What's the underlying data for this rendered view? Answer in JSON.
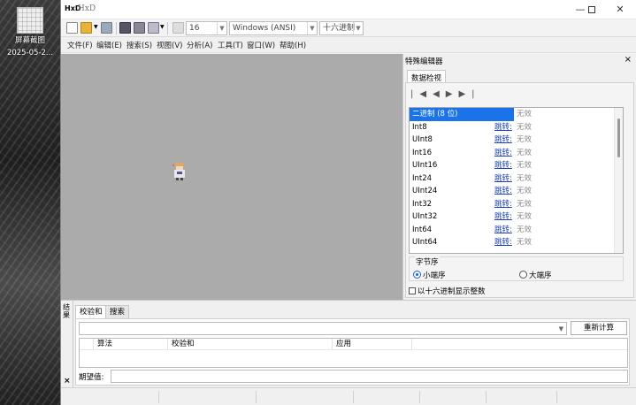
{
  "desktop": {
    "icon_label_line1": "屏幕截图",
    "icon_label_line2": "2025-05-2..."
  },
  "window": {
    "logo": "HxD",
    "title": "HxD",
    "minimize_icon": "minimize-icon",
    "maximize_icon": "maximize-icon",
    "close_icon": "close-icon"
  },
  "toolbar": {
    "bytes_per_row": "16",
    "charset": "Windows (ANSI)",
    "offset_base": "十六进制"
  },
  "menu": [
    "文件(F)",
    "编辑(E)",
    "搜索(S)",
    "视图(V)",
    "分析(A)",
    "工具(T)",
    "窗口(W)",
    "帮助(H)"
  ],
  "special_editor": {
    "title": "特殊编辑器",
    "close": "×",
    "tab": "数据检视",
    "rows": [
      {
        "name": "二进制 (8 位)",
        "jump": "",
        "value": "无效"
      },
      {
        "name": "Int8",
        "jump": "跳转:",
        "value": "无效"
      },
      {
        "name": "UInt8",
        "jump": "跳转:",
        "value": "无效"
      },
      {
        "name": "Int16",
        "jump": "跳转:",
        "value": "无效"
      },
      {
        "name": "UInt16",
        "jump": "跳转:",
        "value": "无效"
      },
      {
        "name": "Int24",
        "jump": "跳转:",
        "value": "无效"
      },
      {
        "name": "UInt24",
        "jump": "跳转:",
        "value": "无效"
      },
      {
        "name": "Int32",
        "jump": "跳转:",
        "value": "无效"
      },
      {
        "name": "UInt32",
        "jump": "跳转:",
        "value": "无效"
      },
      {
        "name": "Int64",
        "jump": "跳转:",
        "value": "无效"
      },
      {
        "name": "UInt64",
        "jump": "跳转:",
        "value": "无效"
      }
    ],
    "byte_order_label": "字节序",
    "little_endian": "小端序",
    "big_endian": "大端序",
    "hex_int_checkbox": "以十六进制显示整数"
  },
  "results": {
    "side_title": "结果",
    "close": "×",
    "tab_checksum": "校验和",
    "tab_search": "搜索",
    "recalc_button": "重新计算",
    "col_algorithm": "算法",
    "col_checksum": "校验和",
    "col_apply": "应用",
    "expected_label": "期望值:"
  },
  "colors": {
    "selection": "#1a73e8",
    "link": "#1a3fb0",
    "editor_bg": "#ababab"
  }
}
